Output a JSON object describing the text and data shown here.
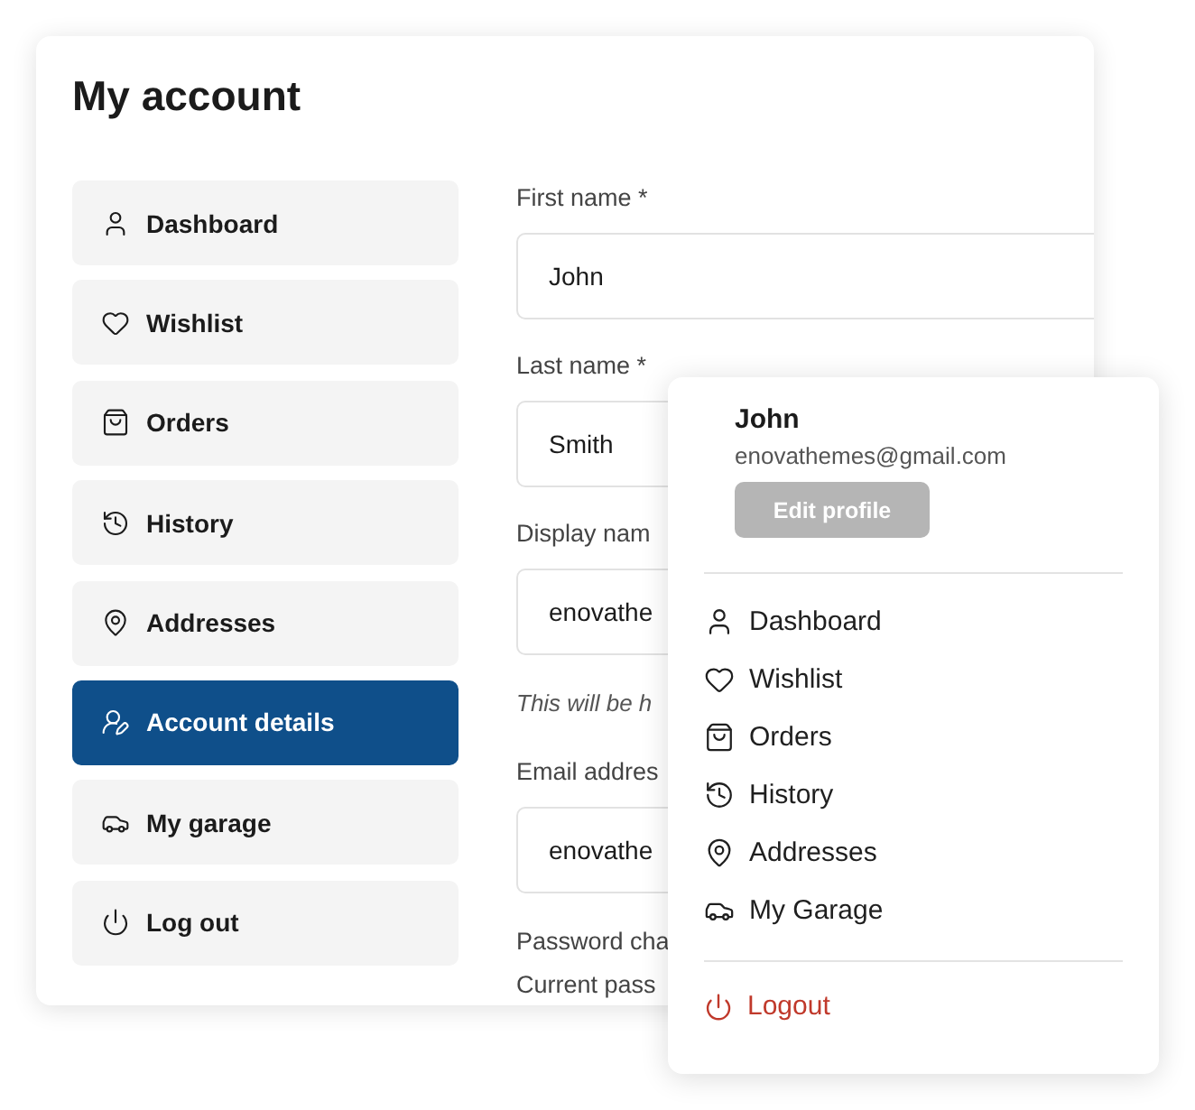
{
  "page": {
    "title": "My account"
  },
  "sidebar": {
    "items": [
      {
        "label": "Dashboard",
        "selected": false
      },
      {
        "label": "Wishlist",
        "selected": false
      },
      {
        "label": "Orders",
        "selected": false
      },
      {
        "label": "History",
        "selected": false
      },
      {
        "label": "Addresses",
        "selected": false
      },
      {
        "label": "Account details",
        "selected": true
      },
      {
        "label": "My garage",
        "selected": false
      },
      {
        "label": "Log out",
        "selected": false
      }
    ]
  },
  "form": {
    "fields": [
      {
        "label": "First name *",
        "value": "John"
      },
      {
        "label": "Last name *",
        "value": "Smith"
      },
      {
        "label": "Display nam",
        "value": "enovathe",
        "hint": "This will be h"
      },
      {
        "label": "Email addres",
        "value": "enovathe"
      }
    ],
    "password_section": "Password cha",
    "current_password_label": "Current pass"
  },
  "account_menu": {
    "name": "John",
    "email": "enovathemes@gmail.com",
    "edit_button": {
      "label": "Edit profile",
      "disabled": true
    },
    "items": [
      {
        "label": "Dashboard"
      },
      {
        "label": "Wishlist"
      },
      {
        "label": "Orders"
      },
      {
        "label": "History"
      },
      {
        "label": "Addresses"
      },
      {
        "label": "My Garage"
      }
    ],
    "logout": "Logout"
  }
}
